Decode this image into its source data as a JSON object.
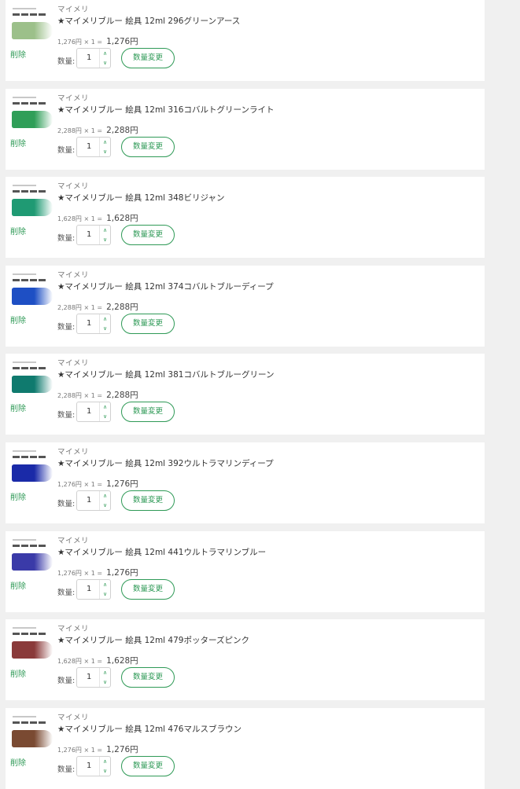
{
  "labels": {
    "delete": "削除",
    "quantity": "数量:",
    "change": "数量変更"
  },
  "items": [
    {
      "maker": "マイメリ",
      "name": "★マイメリブルー 絵具 12ml 296グリーンアース",
      "unit_price": "1,276円 × 1 =",
      "total": "1,276円",
      "qty": "1",
      "color": "#9cc08a"
    },
    {
      "maker": "マイメリ",
      "name": "★マイメリブルー 絵具 12ml 316コバルトグリーンライト",
      "unit_price": "2,288円 × 1 =",
      "total": "2,288円",
      "qty": "1",
      "color": "#2f9e58"
    },
    {
      "maker": "マイメリ",
      "name": "★マイメリブルー 絵具 12ml 348ビリジャン",
      "unit_price": "1,628円 × 1 =",
      "total": "1,628円",
      "qty": "1",
      "color": "#1f9a73"
    },
    {
      "maker": "マイメリ",
      "name": "★マイメリブルー 絵具 12ml 374コバルトブルーディープ",
      "unit_price": "2,288円 × 1 =",
      "total": "2,288円",
      "qty": "1",
      "color": "#1e4fc4"
    },
    {
      "maker": "マイメリ",
      "name": "★マイメリブルー 絵具 12ml 381コバルトブルーグリーン",
      "unit_price": "2,288円 × 1 =",
      "total": "2,288円",
      "qty": "1",
      "color": "#0f7a6e"
    },
    {
      "maker": "マイメリ",
      "name": "★マイメリブルー 絵具 12ml 392ウルトラマリンディープ",
      "unit_price": "1,276円 × 1 =",
      "total": "1,276円",
      "qty": "1",
      "color": "#1a2aa8"
    },
    {
      "maker": "マイメリ",
      "name": "★マイメリブルー 絵具 12ml 441ウルトラマリンブルー",
      "unit_price": "1,276円 × 1 =",
      "total": "1,276円",
      "qty": "1",
      "color": "#3a3aa8"
    },
    {
      "maker": "マイメリ",
      "name": "★マイメリブルー 絵具 12ml 479ポッターズピンク",
      "unit_price": "1,628円 × 1 =",
      "total": "1,628円",
      "qty": "1",
      "color": "#8a3a3a"
    },
    {
      "maker": "マイメリ",
      "name": "★マイメリブルー 絵具 12ml 476マルスブラウン",
      "unit_price": "1,276円 × 1 =",
      "total": "1,276円",
      "qty": "1",
      "color": "#7a4a32"
    }
  ]
}
